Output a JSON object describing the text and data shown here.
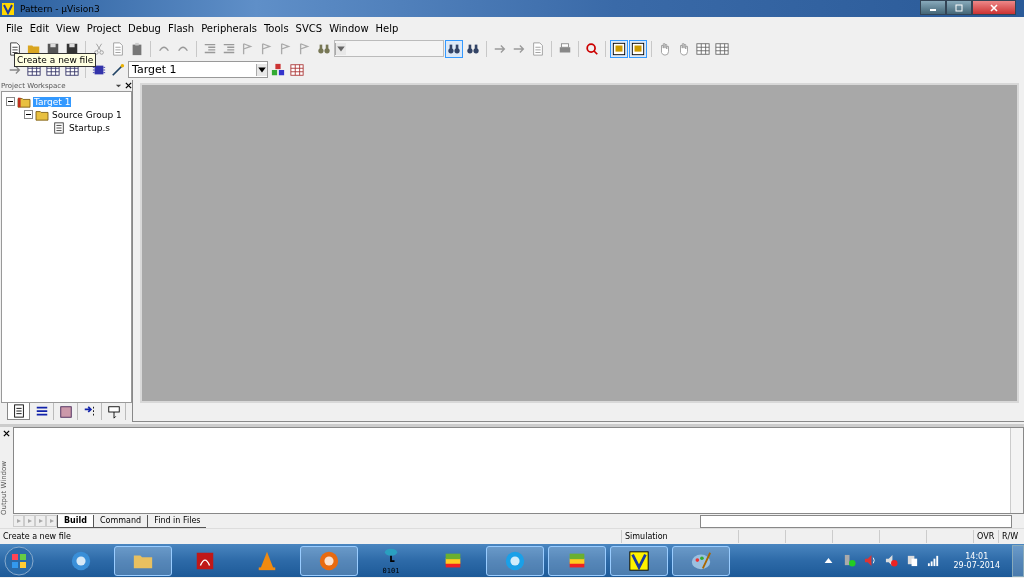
{
  "window": {
    "title": "Pattern  - µVision3"
  },
  "menu": [
    "File",
    "Edit",
    "View",
    "Project",
    "Debug",
    "Flash",
    "Peripherals",
    "Tools",
    "SVCS",
    "Window",
    "Help"
  ],
  "toolbar_1": [
    {
      "kind": "new-file",
      "pressed": false
    },
    {
      "kind": "open",
      "pressed": false
    },
    {
      "kind": "save",
      "pressed": false
    },
    {
      "kind": "save-all",
      "pressed": false
    },
    {
      "kind": "sep"
    },
    {
      "kind": "cut",
      "pressed": false
    },
    {
      "kind": "copy",
      "pressed": false
    },
    {
      "kind": "paste",
      "pressed": false
    },
    {
      "kind": "sep"
    },
    {
      "kind": "undo",
      "pressed": false
    },
    {
      "kind": "redo",
      "pressed": false
    },
    {
      "kind": "sep"
    },
    {
      "kind": "indent",
      "pressed": false
    },
    {
      "kind": "outdent",
      "pressed": false
    },
    {
      "kind": "bookmark",
      "pressed": false
    },
    {
      "kind": "bookmark",
      "pressed": false
    },
    {
      "kind": "bookmark",
      "pressed": false
    },
    {
      "kind": "bookmark",
      "pressed": false
    },
    {
      "kind": "find-files",
      "pressed": false
    },
    {
      "kind": "combo"
    },
    {
      "kind": "find",
      "pressed": true
    },
    {
      "kind": "find",
      "pressed": false
    },
    {
      "kind": "sep"
    },
    {
      "kind": "back",
      "pressed": false
    },
    {
      "kind": "forward",
      "pressed": false
    },
    {
      "kind": "goto",
      "pressed": false
    },
    {
      "kind": "sep"
    },
    {
      "kind": "print",
      "pressed": false
    },
    {
      "kind": "sep"
    },
    {
      "kind": "debug",
      "pressed": false
    },
    {
      "kind": "sep"
    },
    {
      "kind": "window",
      "pressed": true
    },
    {
      "kind": "window",
      "pressed": true
    },
    {
      "kind": "sep"
    },
    {
      "kind": "hand",
      "pressed": false
    },
    {
      "kind": "hand",
      "pressed": false
    },
    {
      "kind": "grid",
      "pressed": false
    },
    {
      "kind": "grid",
      "pressed": false
    }
  ],
  "toolbar_2": [
    {
      "kind": "translate",
      "pressed": false
    },
    {
      "kind": "build",
      "pressed": false
    },
    {
      "kind": "build",
      "pressed": false
    },
    {
      "kind": "build",
      "pressed": false
    },
    {
      "kind": "sep"
    },
    {
      "kind": "download",
      "pressed": false
    },
    {
      "kind": "wand",
      "pressed": false
    },
    {
      "kind": "target-select",
      "value": "Target 1"
    },
    {
      "kind": "components",
      "pressed": false
    },
    {
      "kind": "options",
      "pressed": false
    }
  ],
  "tooltip": "Create a new file",
  "workspace": {
    "title": "Project Workspace",
    "tree": [
      {
        "label": "Target 1",
        "kind": "target",
        "selected": true,
        "expanded": true,
        "children": [
          {
            "label": "Source Group 1",
            "kind": "group",
            "selected": false,
            "expanded": true,
            "children": [
              {
                "label": "Startup.s",
                "kind": "file",
                "selected": false
              }
            ]
          }
        ]
      }
    ],
    "tabs": [
      {
        "kind": "files",
        "selected": true
      },
      {
        "kind": "registers",
        "selected": false
      },
      {
        "kind": "books",
        "selected": false
      },
      {
        "kind": "functions",
        "selected": false
      },
      {
        "kind": "templates",
        "selected": false
      }
    ]
  },
  "output": {
    "title": "Output Window",
    "tabs": [
      {
        "label": "Build",
        "selected": true
      },
      {
        "label": "Command",
        "selected": false
      },
      {
        "label": "Find in Files",
        "selected": false
      }
    ]
  },
  "status_bar": [
    "Create a new file",
    "Simulation",
    "OVR",
    "R/W"
  ],
  "taskbar": {
    "apps": [
      {
        "kind": "ie",
        "active": false
      },
      {
        "kind": "explorer",
        "active": true
      },
      {
        "kind": "pdf",
        "active": false
      },
      {
        "kind": "vlc",
        "active": false
      },
      {
        "kind": "firefox",
        "active": true
      },
      {
        "kind": "robot",
        "active": false,
        "caption": "0101"
      },
      {
        "kind": "stack",
        "active": false
      },
      {
        "kind": "skype",
        "active": true
      },
      {
        "kind": "stack",
        "active": true
      },
      {
        "kind": "uvision",
        "active": true
      },
      {
        "kind": "paint",
        "active": true
      }
    ],
    "time": "14:01",
    "date": "29-07-2014"
  }
}
